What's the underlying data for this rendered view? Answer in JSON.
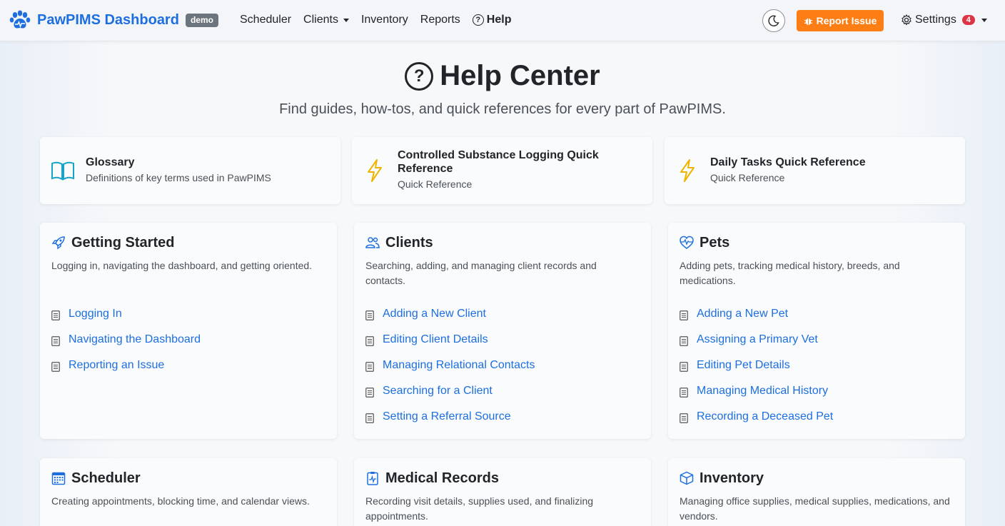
{
  "brand": {
    "name": "PawPIMS Dashboard",
    "badge": "demo"
  },
  "nav": {
    "items": [
      {
        "label": "Scheduler"
      },
      {
        "label": "Clients"
      },
      {
        "label": "Inventory"
      },
      {
        "label": "Reports"
      },
      {
        "label": "Help"
      }
    ],
    "report_label": "Report Issue",
    "settings_label": "Settings",
    "notification_count": "4"
  },
  "header": {
    "title": "Help Center",
    "subtitle": "Find guides, how-tos, and quick references for every part of PawPIMS."
  },
  "quick_cards": [
    {
      "title": "Glossary",
      "subtitle": "Definitions of key terms used in PawPIMS",
      "icon": "book-icon"
    },
    {
      "title": "Controlled Substance Logging Quick Reference",
      "subtitle": "Quick Reference",
      "icon": "lightning-icon"
    },
    {
      "title": "Daily Tasks Quick Reference",
      "subtitle": "Quick Reference",
      "icon": "lightning-icon"
    }
  ],
  "sections": [
    {
      "title": "Getting Started",
      "icon": "rocket-icon",
      "description": "Logging in, navigating the dashboard, and getting oriented.",
      "links": [
        "Logging In",
        "Navigating the Dashboard",
        "Reporting an Issue"
      ]
    },
    {
      "title": "Clients",
      "icon": "people-icon",
      "description": "Searching, adding, and managing client records and contacts.",
      "links": [
        "Adding a New Client",
        "Editing Client Details",
        "Managing Relational Contacts",
        "Searching for a Client",
        "Setting a Referral Source"
      ]
    },
    {
      "title": "Pets",
      "icon": "heart-pulse-icon",
      "description": "Adding pets, tracking medical history, breeds, and medications.",
      "links": [
        "Adding a New Pet",
        "Assigning a Primary Vet",
        "Editing Pet Details",
        "Managing Medical History",
        "Recording a Deceased Pet"
      ]
    },
    {
      "title": "Scheduler",
      "icon": "calendar-icon",
      "description": "Creating appointments, blocking time, and calendar views."
    },
    {
      "title": "Medical Records",
      "icon": "clipboard-pulse-icon",
      "description": "Recording visit details, supplies used, and finalizing appointments."
    },
    {
      "title": "Inventory",
      "icon": "box-icon",
      "description": "Managing office supplies, medical supplies, medications, and vendors."
    }
  ],
  "colors": {
    "brand": "#1d6fe0",
    "accent": "#fd7e14",
    "link": "#1d6fe0",
    "warning_icon": "#f0b400",
    "info_icon": "#17a2c8"
  }
}
